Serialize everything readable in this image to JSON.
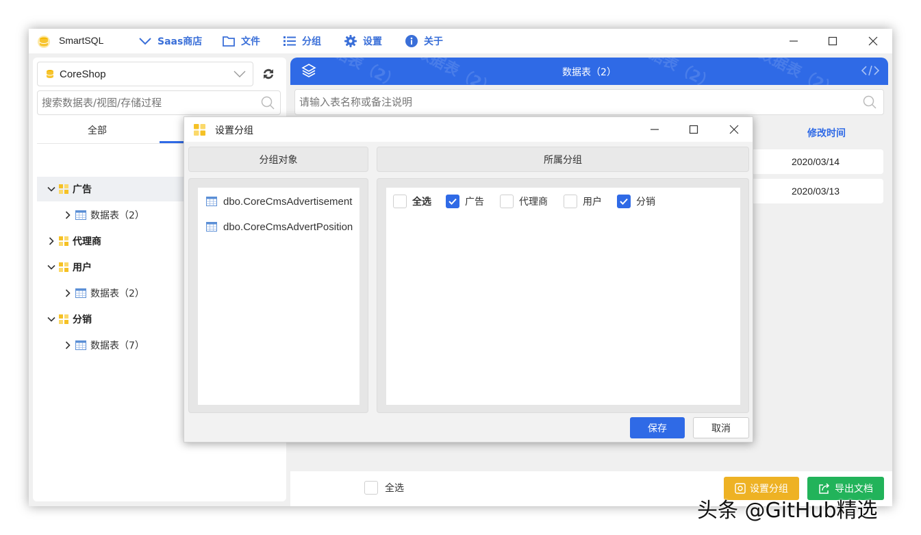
{
  "app": {
    "name": "SmartSQL",
    "menu": [
      {
        "label": "Saas商店",
        "icon": "chevron-down-icon"
      },
      {
        "label": "文件",
        "icon": "folder-icon"
      },
      {
        "label": "分组",
        "icon": "list-icon"
      },
      {
        "label": "设置",
        "icon": "gear-icon"
      },
      {
        "label": "关于",
        "icon": "info-icon"
      }
    ]
  },
  "left": {
    "database": "CoreShop",
    "search_placeholder": "搜索数据表/视图/存储过程",
    "tab_all": "全部",
    "tree": [
      {
        "group": "广告",
        "expanded": true,
        "child": "数据表（2）"
      },
      {
        "group": "代理商",
        "expanded": false
      },
      {
        "group": "用户",
        "expanded": true,
        "child": "数据表（2）"
      },
      {
        "group": "分销",
        "expanded": true,
        "child": "数据表（7）"
      }
    ]
  },
  "right": {
    "header_title": "数据表（2）",
    "search_placeholder": "请输入表名称或备注说明",
    "column_modified": "修改时间",
    "rows": [
      "2020/03/14",
      "2020/03/13"
    ],
    "select_all": "全选",
    "set_group_button": "设置分组",
    "export_button": "导出文档"
  },
  "dialog": {
    "title": "设置分组",
    "objects_header": "分组对象",
    "groups_header": "所属分组",
    "objects": [
      "dbo.CoreCmsAdvertisement",
      "dbo.CoreCmsAdvertPosition"
    ],
    "select_all": "全选",
    "groups": [
      {
        "label": "广告",
        "checked": true
      },
      {
        "label": "代理商",
        "checked": false
      },
      {
        "label": "用户",
        "checked": false
      },
      {
        "label": "分销",
        "checked": true
      }
    ],
    "save": "保存",
    "cancel": "取消"
  },
  "watermark": "头条 @GitHub精选",
  "colors": {
    "accent": "#2f6ae6",
    "warning": "#eeb224",
    "success": "#22b35a"
  }
}
